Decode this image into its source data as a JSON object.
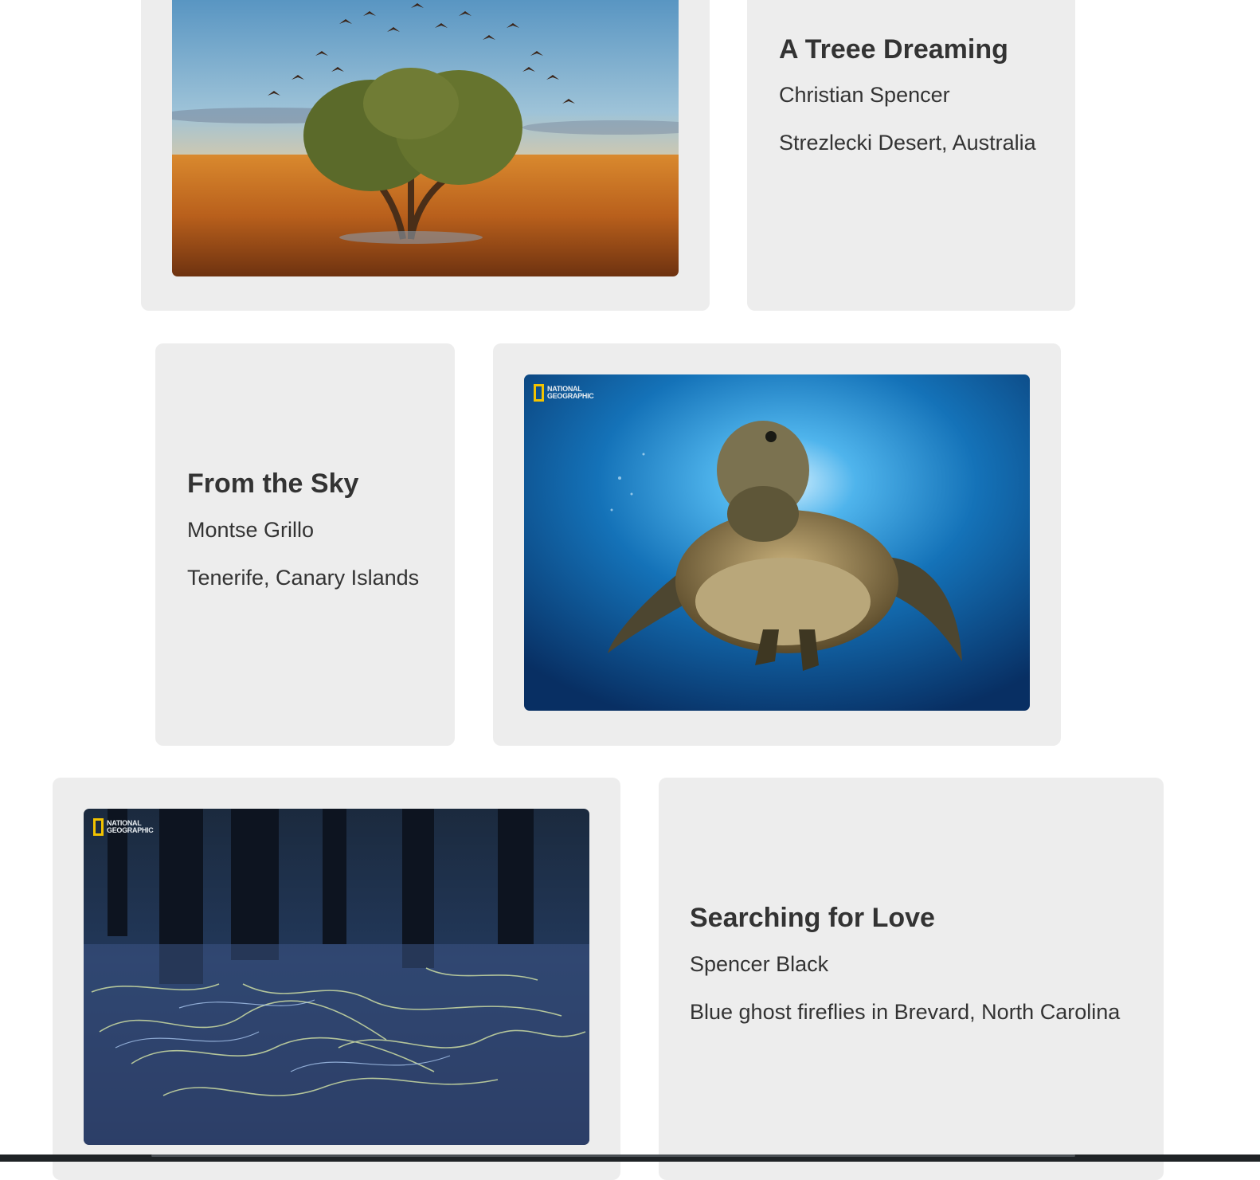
{
  "cards": [
    {
      "title": "A Treee Dreaming",
      "photographer": "Christian Spencer",
      "location": "Strezlecki Desert, Australia",
      "image": "tree-with-birds-desert-photo"
    },
    {
      "title": "From the Sky",
      "photographer": "Montse Grillo",
      "location": "Tenerife, Canary Islands",
      "image": "sea-turtle-underwater-photo",
      "watermark": [
        "NATIONAL",
        "GEOGRAPHIC"
      ]
    },
    {
      "title": "Searching for Love",
      "photographer": "Spencer Black",
      "location": "Blue ghost fireflies in Brevard, North Carolina",
      "image": "fireflies-forest-night-photo",
      "watermark": [
        "NATIONAL",
        "GEOGRAPHIC"
      ]
    }
  ],
  "colors": {
    "card_background": "#ededed",
    "text": "#333333",
    "page_background": "#ffffff"
  }
}
